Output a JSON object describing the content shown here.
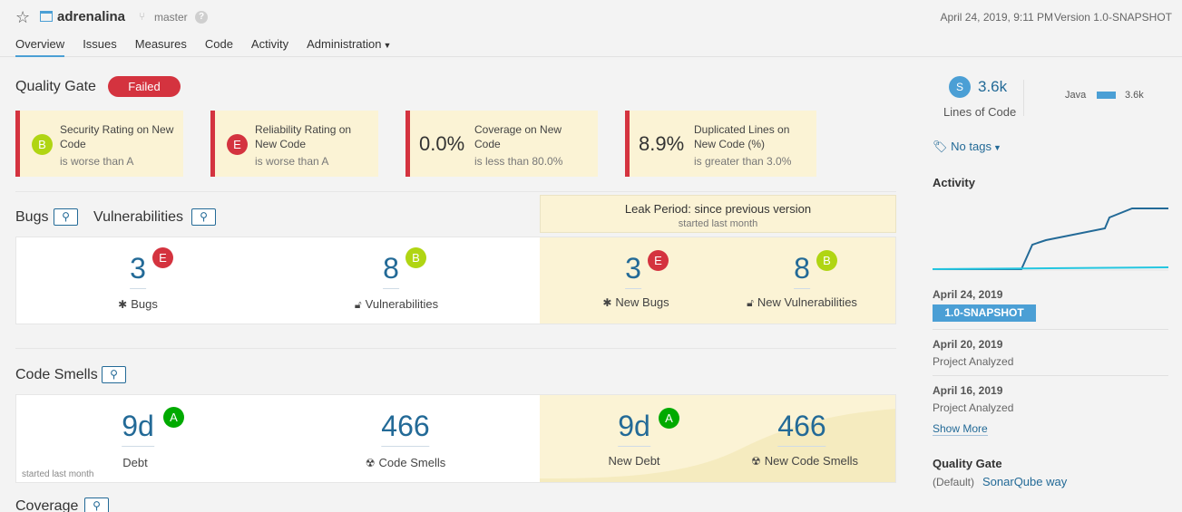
{
  "header": {
    "project_name": "adrenalina",
    "branch": "master",
    "help": "?",
    "date": "April 24, 2019, 9:11 PM",
    "version": "Version 1.0-SNAPSHOT"
  },
  "nav": [
    "Overview",
    "Issues",
    "Measures",
    "Code",
    "Activity",
    "Administration"
  ],
  "quality_gate": {
    "title": "Quality Gate",
    "status": "Failed",
    "conditions": [
      {
        "rating": "B",
        "title1": "Security Rating on New",
        "title2": "Code",
        "sub": "is worse than A"
      },
      {
        "rating": "E",
        "title1": "Reliability Rating on",
        "title2": "New Code",
        "sub": "is worse than A"
      },
      {
        "value": "0.0%",
        "title1": "Coverage on New",
        "title2": "Code",
        "sub": "is less than 80.0%"
      },
      {
        "value": "8.9%",
        "title1": "Duplicated Lines on",
        "title2": "New Code (%)",
        "sub": "is greater than 3.0%"
      }
    ]
  },
  "leak": {
    "title": "Leak Period: since previous version",
    "sub": "started last month"
  },
  "bugs_section": {
    "title_bugs": "Bugs",
    "title_vulns": "Vulnerabilities",
    "bugs": {
      "value": "3",
      "rating": "E",
      "label": "Bugs"
    },
    "vulns": {
      "value": "8",
      "rating": "B",
      "label": "Vulnerabilities"
    },
    "new_bugs": {
      "value": "3",
      "rating": "E",
      "label": "New Bugs"
    },
    "new_vulns": {
      "value": "8",
      "rating": "B",
      "label": "New Vulnerabilities"
    }
  },
  "smells_section": {
    "title": "Code Smells",
    "debt": {
      "value": "9d",
      "rating": "A",
      "label": "Debt"
    },
    "smells": {
      "value": "466",
      "label": "Code Smells"
    },
    "new_debt": {
      "value": "9d",
      "rating": "A",
      "label": "New Debt"
    },
    "new_smells": {
      "value": "466",
      "label": "New Code Smells"
    },
    "started": "started last month"
  },
  "coverage_section": {
    "title": "Coverage"
  },
  "sidebar": {
    "ncloc_badge": "S",
    "ncloc_value": "3.6k",
    "ncloc_label": "Lines of Code",
    "language": "Java",
    "language_value": "3.6k",
    "tags": "No tags",
    "activity_title": "Activity",
    "events": [
      {
        "date": "April 24, 2019",
        "tag": "1.0-SNAPSHOT"
      },
      {
        "date": "April 20, 2019",
        "sub": "Project Analyzed"
      },
      {
        "date": "April 16, 2019",
        "sub": "Project Analyzed"
      }
    ],
    "show_more": "Show More",
    "qg_title": "Quality Gate",
    "qg_default": "(Default)",
    "qg_name": "SonarQube way"
  },
  "colors": {
    "rating_A": "#00aa00",
    "rating_B": "#b0d513",
    "rating_E": "#d4333f",
    "accent": "#4b9fd5",
    "link": "#236a97",
    "leak_bg": "#fbf3d5"
  }
}
